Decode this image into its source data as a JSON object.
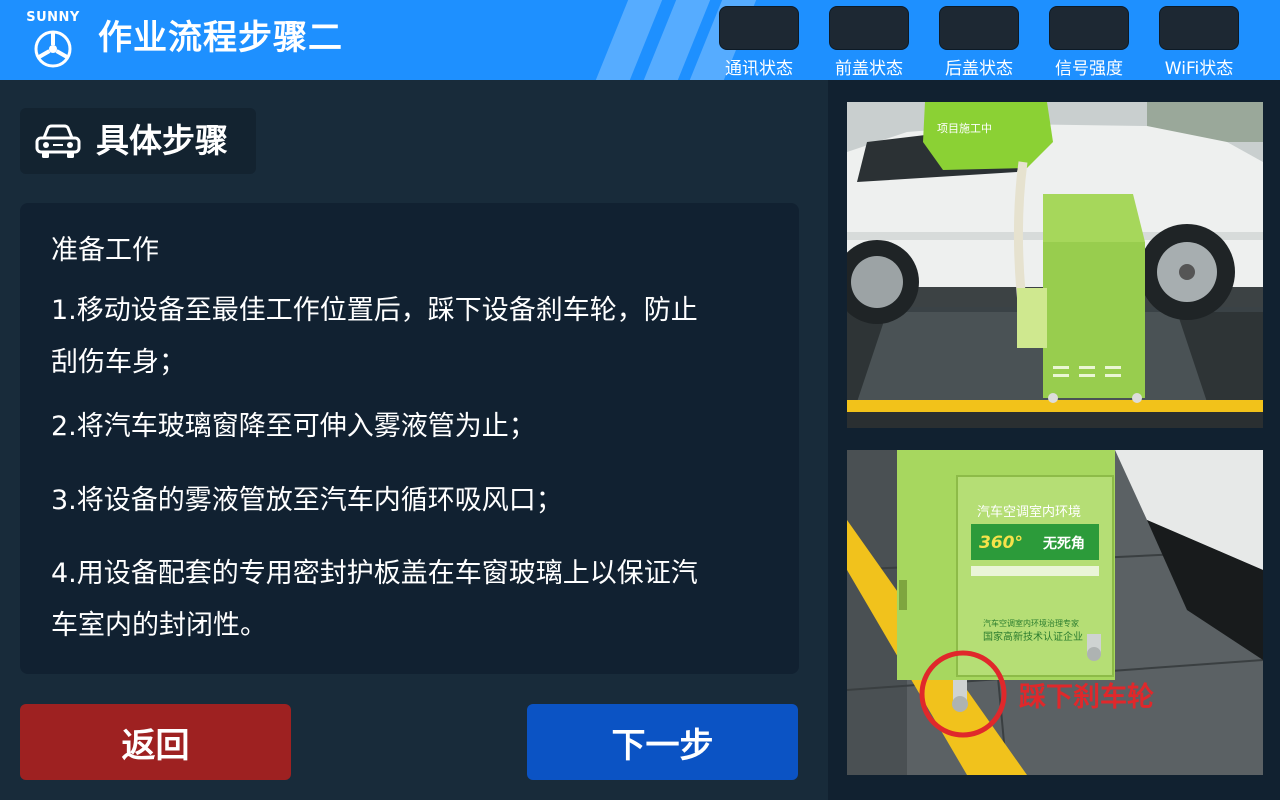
{
  "header": {
    "brand": "SUNNY",
    "title": "作业流程步骤二",
    "statuses": [
      {
        "label": "通讯状态"
      },
      {
        "label": "前盖状态"
      },
      {
        "label": "后盖状态"
      },
      {
        "label": "信号强度"
      },
      {
        "label": "WiFi状态"
      }
    ]
  },
  "section": {
    "title": "具体步骤",
    "icon": "car-icon"
  },
  "content": {
    "heading": "准备工作",
    "steps": [
      {
        "line1": "1.移动设备至最佳工作位置后，踩下设备刹车轮，防止",
        "line2": "刮伤车身；"
      },
      {
        "line1": "2.将汽车玻璃窗降至可伸入雾液管为止；"
      },
      {
        "line1": "3.将设备的雾液管放至汽车内循环吸风口；"
      },
      {
        "line1": "4.用设备配套的专用密封护板盖在车窗玻璃上以保证汽",
        "line2": "车室内的封闭性。"
      }
    ]
  },
  "buttons": {
    "back": "返回",
    "next": "下一步"
  },
  "photos": {
    "photo1": {
      "cover_text": "项目施工中"
    },
    "photo2": {
      "panel_heading": "汽车空调室内环境",
      "banner_number": "360°",
      "banner_text": "无死角",
      "panel_sub1": "汽车空调室内环境治理专家",
      "panel_sub2": "国家高新技术认证企业",
      "annotation": "踩下刹车轮"
    }
  },
  "colors": {
    "header_bg": "#1e90ff",
    "page_bg": "#182b3a",
    "back_button": "#9e2121",
    "next_button": "#0b53c4",
    "annotation_red": "#e0282b"
  }
}
